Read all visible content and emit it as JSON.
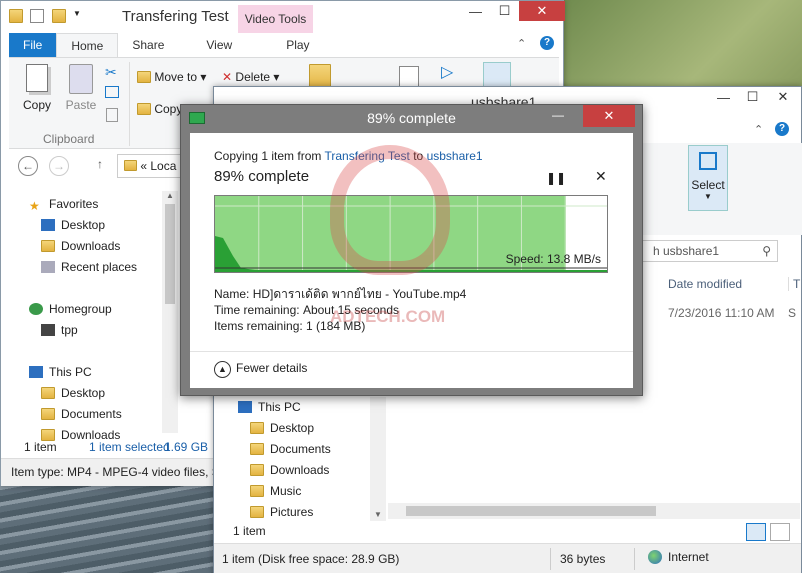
{
  "win1": {
    "title": "Transfering Test",
    "context_tab": "Video Tools",
    "tabs": [
      "File",
      "Home",
      "Share",
      "View",
      "Play"
    ],
    "ribbon": {
      "copy": "Copy",
      "paste": "Paste",
      "move_to": "Move to",
      "delete": "Delete",
      "copy_to": "Copy",
      "group_clipboard": "Clipboard"
    },
    "address": "« Loca",
    "nav": {
      "favorites": "Favorites",
      "desktop": "Desktop",
      "downloads": "Downloads",
      "recent": "Recent places",
      "homegroup": "Homegroup",
      "tpp": "tpp",
      "thispc": "This PC",
      "pc_desktop": "Desktop",
      "documents": "Documents",
      "downloads2": "Downloads"
    },
    "status_items": "1 item",
    "status_selected": "1 item selected",
    "status_size": "1.69 GB",
    "details": "Item type: MP4 - MPEG-4 video files, S"
  },
  "win2": {
    "title": "usbshare1",
    "select_label": "Select",
    "search_placeholder": "h usbshare1",
    "col_date": "Date modified",
    "col_type": "T",
    "row_date": "7/23/2016 11:10 AM",
    "row_type": "S",
    "nav": {
      "thispc": "This PC",
      "desktop": "Desktop",
      "documents": "Documents",
      "downloads": "Downloads",
      "music": "Music",
      "pictures": "Pictures"
    },
    "status_items": "1 item",
    "status_disk": "1 item (Disk free space: 28.9 GB)",
    "status_bytes": "36 bytes",
    "status_zone": "Internet"
  },
  "dialog": {
    "title": "89% complete",
    "copying_prefix": "Copying 1 item from ",
    "source": "Transfering Test",
    "to": " to ",
    "dest": "usbshare1",
    "heading": "89% complete",
    "progress": 0.89,
    "speed": "Speed: 13.8 MB/s",
    "name_label": "Name:",
    "name_value": "HD]ดาราเด้ติด พากย์ไทย - YouTube.mp4",
    "time_label": "Time remaining:",
    "time_value": "About 15 seconds",
    "items_label": "Items remaining:",
    "items_value": "1 (184 MB)",
    "fewer": "Fewer details"
  },
  "watermark": "ADTECH.COM",
  "colors": {
    "accent": "#1979ca",
    "progress_green": "#8fd784",
    "close_red": "#c74040",
    "dialog_gray": "#7d7d7d"
  }
}
